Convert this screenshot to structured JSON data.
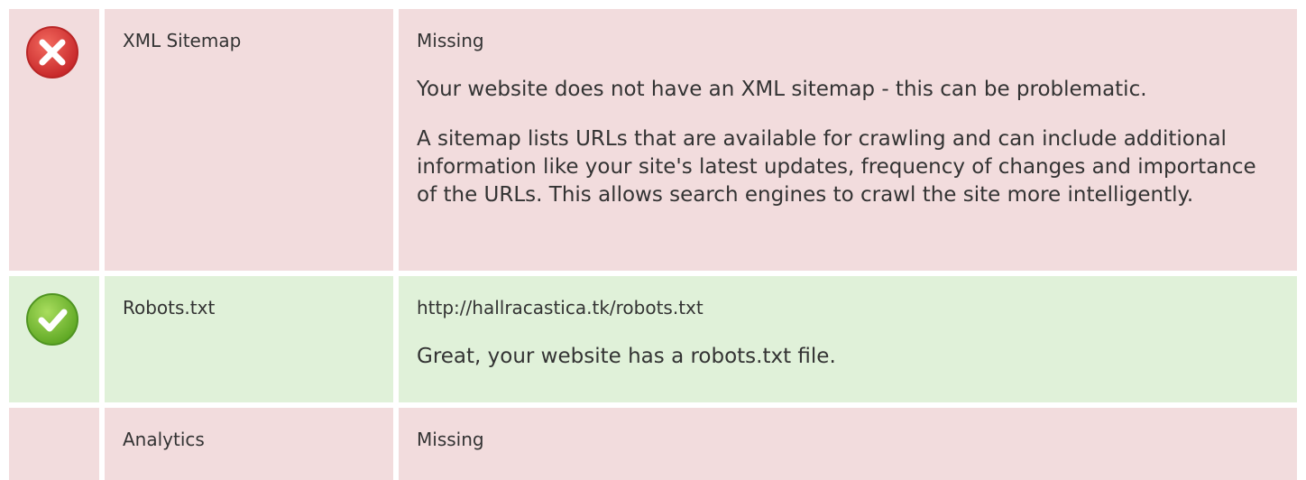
{
  "rows": [
    {
      "status": "fail",
      "icon": "cross-icon",
      "name": "XML Sitemap",
      "value": "Missing",
      "description": "Your website does not have an XML sitemap - this can be problematic.",
      "details": "A sitemap lists URLs that are available for crawling and can include additional information like your site's latest updates, frequency of changes and importance of the URLs. This allows search engines to crawl the site more intelligently."
    },
    {
      "status": "pass",
      "icon": "check-icon",
      "name": "Robots.txt",
      "value": "http://hallracastica.tk/robots.txt",
      "description": "Great, your website has a robots.txt file."
    },
    {
      "status": "fail",
      "name": "Analytics",
      "value": "Missing"
    }
  ],
  "colors": {
    "fail_bg": "#f2dcdd",
    "pass_bg": "#e0f1d9",
    "fail_icon": "#e0443a",
    "pass_icon": "#7cbf3a"
  }
}
